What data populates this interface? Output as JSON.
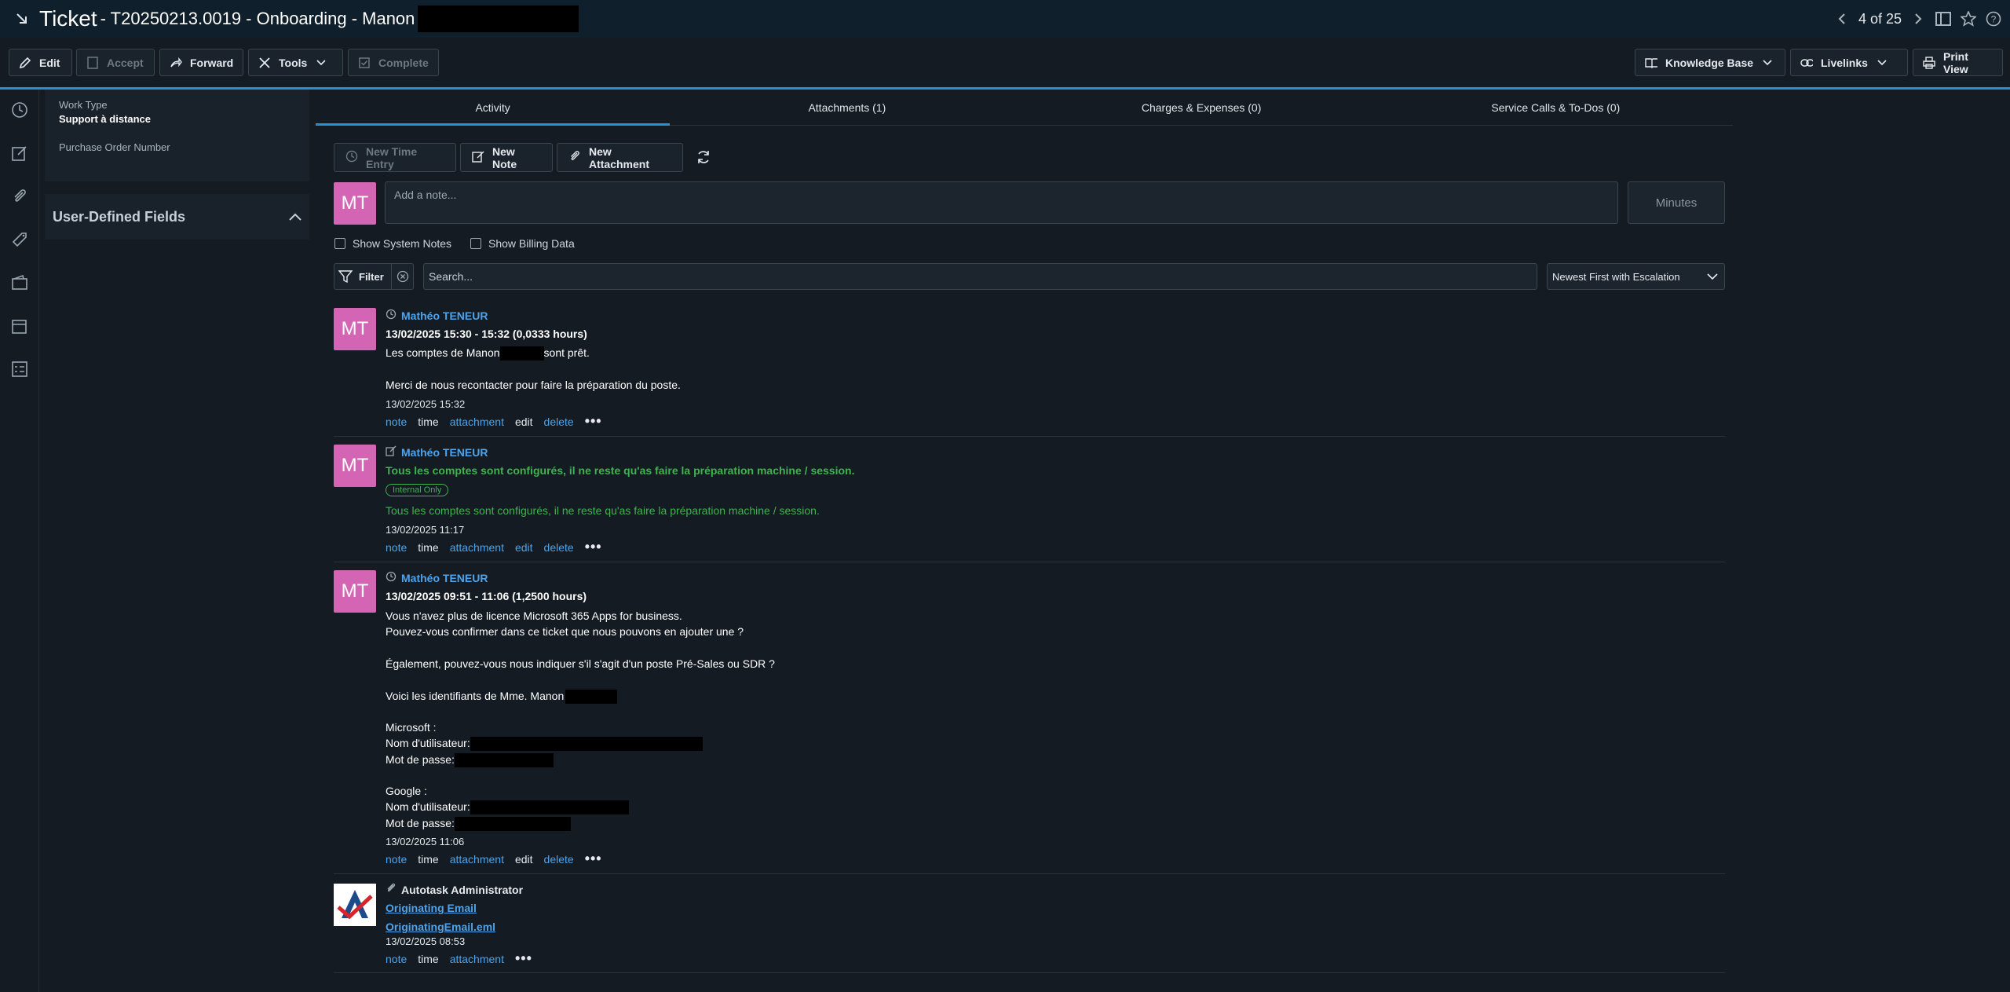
{
  "title": {
    "main": "Ticket",
    "rest": "- T20250213.0019 - Onboarding - Manon",
    "pager": "4 of 25"
  },
  "toolbar": {
    "edit": "Edit",
    "accept": "Accept",
    "forward": "Forward",
    "tools": "Tools",
    "complete": "Complete",
    "knowledge_base": "Knowledge Base",
    "livelinks": "Livelinks",
    "print_view": "Print View"
  },
  "left_panel": {
    "work_type_label": "Work Type",
    "work_type_value": "Support à distance",
    "po_label": "Purchase Order Number",
    "udf_title": "User-Defined Fields"
  },
  "tabs": [
    "Activity",
    "Attachments (1)",
    "Charges & Expenses (0)",
    "Service Calls & To-Dos (0)"
  ],
  "actions": {
    "new_time_entry": "New Time Entry",
    "new_note": "New Note",
    "new_attachment": "New Attachment"
  },
  "composer": {
    "avatar": "MT",
    "placeholder": "Add a note...",
    "minutes": "Minutes"
  },
  "options": {
    "system_notes": "Show System Notes",
    "billing_data": "Show Billing Data"
  },
  "filter": {
    "label": "Filter",
    "search_placeholder": "Search...",
    "sort": "Newest First with Escalation"
  },
  "entries": [
    {
      "avatar": "MT",
      "author": "Mathéo TENEUR",
      "header": "13/02/2025 15:30 - 15:32 (0,0333 hours)",
      "line1a": "Les comptes de Manon",
      "line1b": "sont prêt.",
      "line2": "Merci de nous recontacter pour faire la préparation du poste.",
      "date": "13/02/2025 15:32"
    },
    {
      "avatar": "MT",
      "author": "Mathéo TENEUR",
      "header": "Tous les comptes sont configurés, il ne reste qu'as faire la préparation machine / session.",
      "badge": "Internal Only",
      "body": "Tous les comptes sont configurés, il ne reste qu'as faire la préparation machine / session.",
      "date": "13/02/2025 11:17"
    },
    {
      "avatar": "MT",
      "author": "Mathéo TENEUR",
      "header": "13/02/2025 09:51 - 11:06 (1,2500 hours)",
      "l1": "Vous n'avez plus de licence Microsoft 365 Apps for business.",
      "l2": "Pouvez-vous confirmer dans ce ticket que nous pouvons en ajouter une ?",
      "l3": "Également, pouvez-vous nous indiquer s'il s'agit d'un poste Pré-Sales ou SDR ?",
      "l4": "Voici les identifiants de Mme. Manon",
      "l5": "Microsoft :",
      "l6": "Nom d'utilisateur:",
      "l7": "Mot de passe:",
      "l8": "Google :",
      "l9": "Nom d'utilisateur:",
      "l10": "Mot de passe:",
      "date": "13/02/2025 11:06"
    },
    {
      "author": "Autotask Administrator",
      "link1": "Originating Email",
      "link2": "OriginatingEmail.eml",
      "date": "13/02/2025 08:53"
    }
  ],
  "entry_links": {
    "note": "note",
    "time": "time",
    "attachment": "attachment",
    "edit": "edit",
    "delete": "delete"
  }
}
